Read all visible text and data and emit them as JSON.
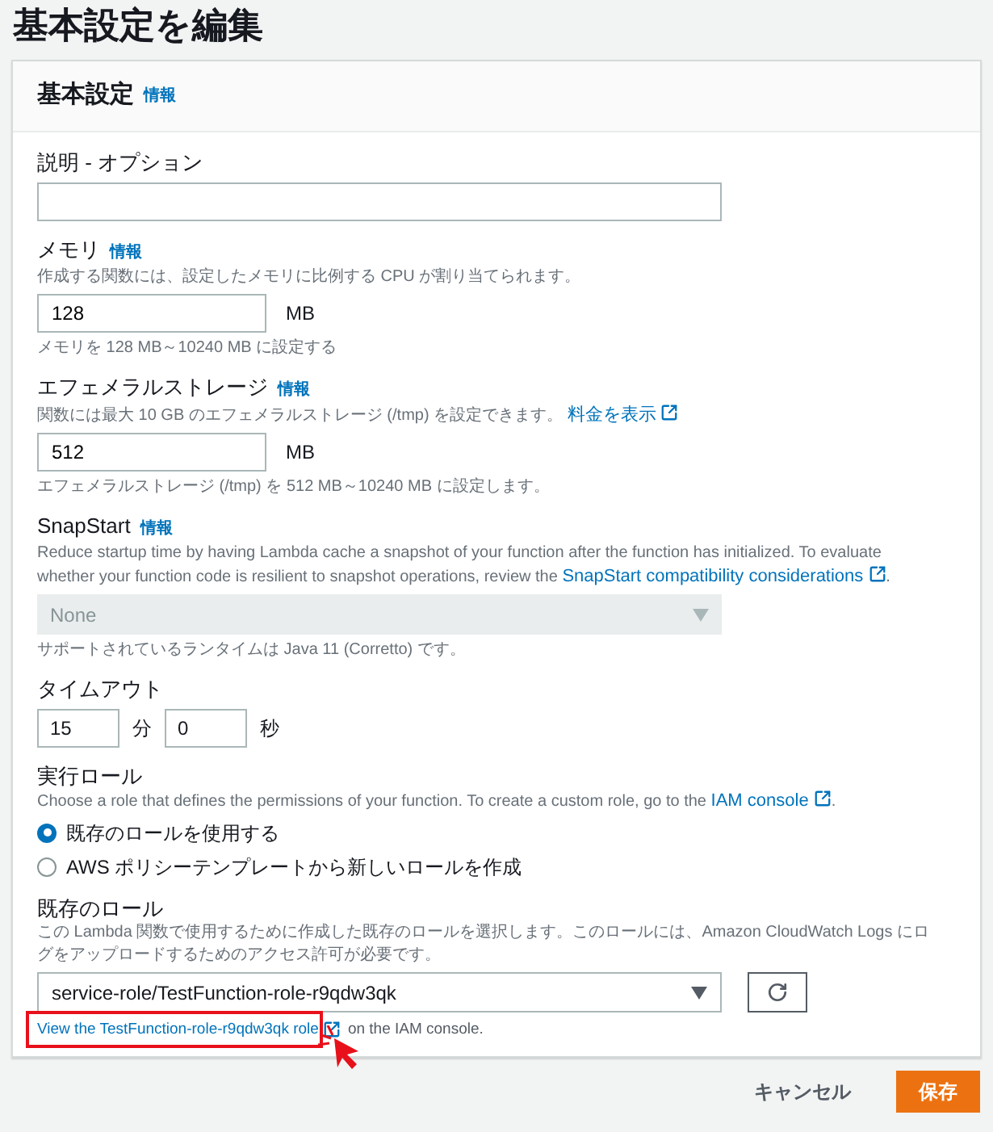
{
  "title": "基本設定を編集",
  "panel": {
    "heading": "基本設定",
    "info": "情報"
  },
  "sections": [
    {
      "kind": "text",
      "label": "説明 - オプション"
    },
    {
      "kind": "unit",
      "label": "メモリ",
      "info": "情報",
      "description": {
        "text": "作成する関数には、設定したメモリに比例する CPU が割り当てられます。"
      },
      "value": "128",
      "unit": "MB",
      "hint": "メモリを 128 MB～10240 MB に設定する"
    },
    {
      "kind": "unit",
      "label": "エフェメラルストレージ",
      "info": "情報",
      "description": {
        "text": "関数には最大 10 GB のエフェメラルストレージ (/tmp) を設定できます。",
        "link": "料金を表示",
        "external": true
      },
      "value": "512",
      "unit": "MB",
      "hint": "エフェメラルストレージ (/tmp) を 512 MB～10240 MB に設定します。"
    },
    {
      "kind": "select",
      "label": "SnapStart",
      "info": "情報",
      "description": {
        "text": "Reduce startup time by having Lambda cache a snapshot of your function after the function has initialized. To evaluate whether your function code is resilient to snapshot operations, review the",
        "link": "SnapStart compatibility considerations",
        "external": true,
        "after": "."
      },
      "value": "None",
      "disabled": true,
      "hint": "サポートされているランタイムは Java 11 (Corretto) です。"
    },
    {
      "kind": "timeout",
      "label": "タイムアウト",
      "minutes": "15",
      "minutes_unit": "分",
      "seconds": "0",
      "seconds_unit": "秒"
    },
    {
      "kind": "radio",
      "label": "実行ロール",
      "description": {
        "text": "Choose a role that defines the permissions of your function. To create a custom role, go to the",
        "link": "IAM console",
        "external": true,
        "after": "."
      },
      "options": [
        {
          "label": "既存のロールを使用する",
          "selected": true
        },
        {
          "label": "AWS ポリシーテンプレートから新しいロールを作成",
          "selected": false
        }
      ]
    },
    {
      "kind": "role",
      "label": "既存のロール",
      "description": {
        "text": "この Lambda 関数で使用するために作成した既存のロールを選択します。このロールには、Amazon CloudWatch Logs にログをアップロードするためのアクセス許可が必要です。"
      },
      "value": "service-role/TestFunction-role-r9qdw3qk",
      "disabled": false,
      "view_link": {
        "text": "View the TestFunction-role-r9qdw3qk role",
        "after": "on the IAM console.",
        "highlighted": true
      }
    }
  ],
  "buttons": {
    "cancel": "キャンセル",
    "save": "保存"
  }
}
